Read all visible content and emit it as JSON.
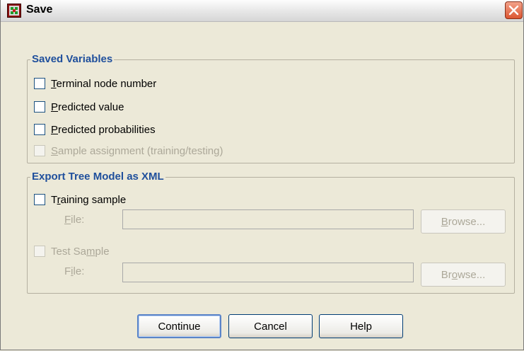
{
  "window": {
    "title": "Save",
    "app_icon": "spss-save-icon",
    "close_icon": "close-icon"
  },
  "saved_variables": {
    "legend": "Saved Variables",
    "options": [
      {
        "mnemonic": "T",
        "rest": "erminal node number",
        "checked": false,
        "enabled": true
      },
      {
        "mnemonic": "P",
        "rest": "redicted value",
        "checked": false,
        "enabled": true
      },
      {
        "mnemonic": "P",
        "rest": "redicted probabilities",
        "checked": false,
        "enabled": true
      },
      {
        "mnemonic": "S",
        "rest": "ample assignment (training/testing)",
        "checked": false,
        "enabled": false
      }
    ]
  },
  "export": {
    "legend": "Export Tree Model as XML",
    "training": {
      "pre": "T",
      "mnemonic": "r",
      "post": "aining sample",
      "checked": false,
      "enabled": true,
      "file_pre": "",
      "file_mnemonic": "F",
      "file_post": "ile:",
      "file_value": "",
      "browse_pre": "",
      "browse_mnemonic": "B",
      "browse_post": "rowse..."
    },
    "test": {
      "pre": "Test Sa",
      "mnemonic": "m",
      "post": "ple",
      "checked": false,
      "enabled": false,
      "file_pre": "F",
      "file_mnemonic": "i",
      "file_post": "le:",
      "file_value": "",
      "browse_pre": "Br",
      "browse_mnemonic": "o",
      "browse_post": "wse..."
    }
  },
  "buttons": {
    "continue": "Continue",
    "cancel": "Cancel",
    "help": "Help"
  },
  "colors": {
    "legend": "#1f4f9c",
    "dialog_bg": "#ece9d8",
    "disabled_text": "#aca899"
  }
}
